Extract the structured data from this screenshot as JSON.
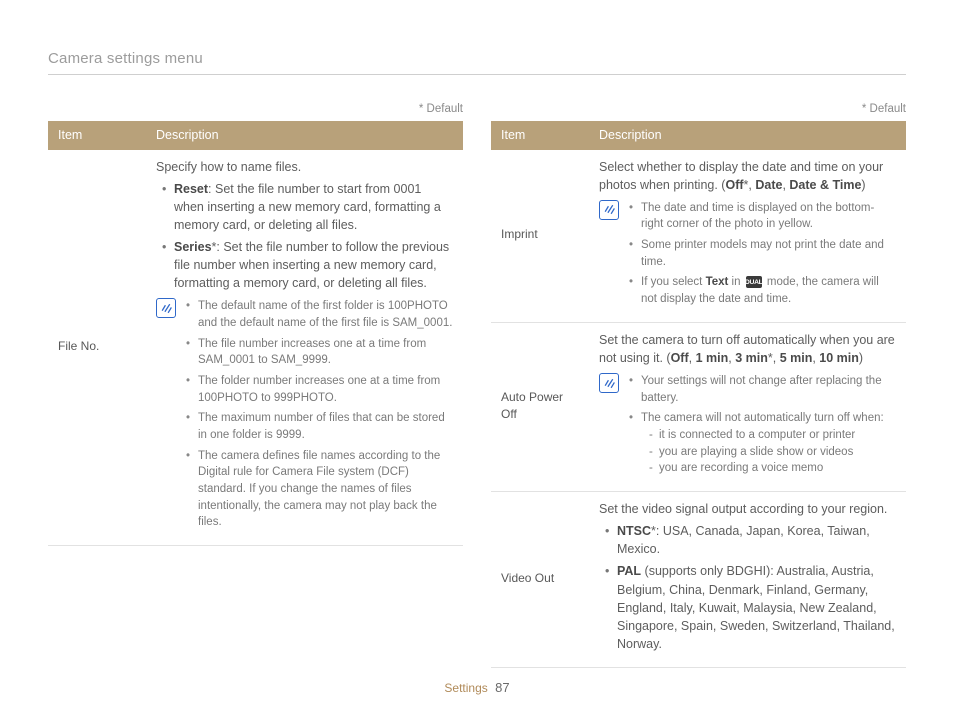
{
  "section_title": "Camera settings menu",
  "default_marker": "* Default",
  "headers": {
    "item": "Item",
    "desc": "Description"
  },
  "footer": {
    "section": "Settings",
    "page": "87"
  },
  "left": {
    "file_no": {
      "label": "File No.",
      "intro": "Specify how to name files.",
      "reset_lead": "Reset",
      "reset_text": ": Set the file number to start from 0001 when inserting a new memory card, formatting a memory card, or deleting all files.",
      "series_lead": "Series",
      "series_text": "*: Set the file number to follow the previous file number when inserting a new memory card, formatting a memory card, or deleting all files.",
      "notes": [
        "The default name of the first folder is 100PHOTO and the default name of the first file is SAM_0001.",
        "The file number increases one at a time from SAM_0001 to SAM_9999.",
        "The folder number increases one at a time from 100PHOTO to 999PHOTO.",
        "The maximum number of files that can be stored in one folder is 9999.",
        "The camera defines file names according to the Digital rule for Camera File system (DCF) standard. If you change the names of files intentionally, the camera may not play back the files."
      ]
    }
  },
  "right": {
    "imprint": {
      "label": "Imprint",
      "intro_pre": "Select whether to display the date and time on your photos when printing. (",
      "opt_off": "Off",
      "sep": ", ",
      "opt_date": "Date",
      "opt_datetime": "Date & Time",
      "intro_post": ")",
      "notes": {
        "n0": "The date and time is displayed on the bottom-right corner of the photo in yellow.",
        "n1": "Some printer models may not print the date and time.",
        "n2_pre": "If you select ",
        "n2_bold": "Text",
        "n2_mid": " in ",
        "n2_post": " mode, the camera will not display the date and time."
      }
    },
    "auto_power_off": {
      "label": "Auto Power Off",
      "intro_pre": "Set the camera to turn off automatically when you are not using it. (",
      "o_off": "Off",
      "o_1": "1 min",
      "o_3": "3 min",
      "o_5": "5 min",
      "o_10": "10 min",
      "intro_post": ")",
      "notes": {
        "n0": "Your settings will not change after replacing the battery.",
        "n1": "The camera will not automatically turn off when:",
        "sub": [
          "it is connected to a computer or printer",
          "you are playing a slide show or videos",
          "you are recording a voice memo"
        ]
      }
    },
    "video_out": {
      "label": "Video Out",
      "intro": "Set the video signal output according to your region.",
      "ntsc_lead": "NTSC",
      "ntsc_text": "*: USA, Canada, Japan, Korea, Taiwan, Mexico.",
      "pal_lead": "PAL",
      "pal_text": " (supports only BDGHI): Australia, Austria, Belgium, China, Denmark, Finland, Germany, England, Italy, Kuwait, Malaysia, New Zealand, Singapore, Spain, Sweden, Switzerland, Thailand, Norway."
    }
  }
}
